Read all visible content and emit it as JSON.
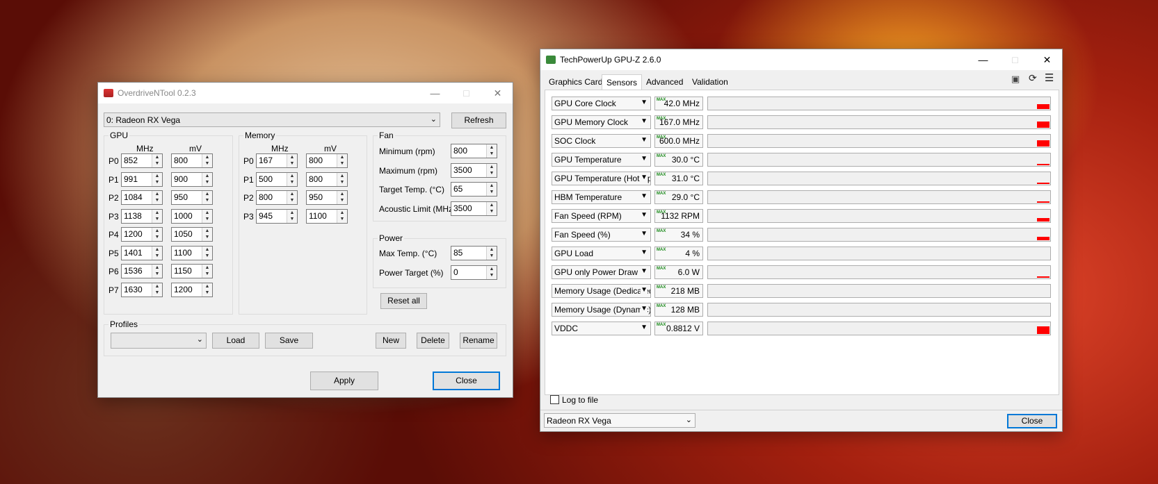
{
  "odnt": {
    "title": "OverdriveNTool 0.2.3",
    "device": "0: Radeon RX Vega",
    "refresh": "Refresh",
    "gpu_caption": "GPU",
    "memory_caption": "Memory",
    "fan_caption": "Fan",
    "power_caption": "Power",
    "profiles_caption": "Profiles",
    "mhz": "MHz",
    "mv": "mV",
    "gpu_states": [
      {
        "label": "P0",
        "mhz": "852",
        "mv": "800"
      },
      {
        "label": "P1",
        "mhz": "991",
        "mv": "900"
      },
      {
        "label": "P2",
        "mhz": "1084",
        "mv": "950"
      },
      {
        "label": "P3",
        "mhz": "1138",
        "mv": "1000"
      },
      {
        "label": "P4",
        "mhz": "1200",
        "mv": "1050"
      },
      {
        "label": "P5",
        "mhz": "1401",
        "mv": "1100"
      },
      {
        "label": "P6",
        "mhz": "1536",
        "mv": "1150"
      },
      {
        "label": "P7",
        "mhz": "1630",
        "mv": "1200"
      }
    ],
    "mem_states": [
      {
        "label": "P0",
        "mhz": "167",
        "mv": "800"
      },
      {
        "label": "P1",
        "mhz": "500",
        "mv": "800"
      },
      {
        "label": "P2",
        "mhz": "800",
        "mv": "950"
      },
      {
        "label": "P3",
        "mhz": "945",
        "mv": "1100"
      }
    ],
    "fan": [
      {
        "label": "Minimum (rpm)",
        "value": "800"
      },
      {
        "label": "Maximum (rpm)",
        "value": "3500"
      },
      {
        "label": "Target Temp. (°C)",
        "value": "65"
      },
      {
        "label": "Acoustic Limit (MHz)",
        "value": "3500"
      }
    ],
    "power": [
      {
        "label": "Max Temp. (°C)",
        "value": "85"
      },
      {
        "label": "Power Target (%)",
        "value": "0"
      }
    ],
    "reset_all": "Reset all",
    "profile_value": "",
    "load": "Load",
    "save": "Save",
    "new": "New",
    "delete": "Delete",
    "rename": "Rename",
    "apply": "Apply",
    "close": "Close"
  },
  "gpuz": {
    "title": "TechPowerUp GPU-Z 2.6.0",
    "tabs": [
      "Graphics Card",
      "Sensors",
      "Advanced",
      "Validation"
    ],
    "active_tab": 1,
    "sensors": [
      {
        "name": "GPU Core Clock",
        "value": "42.0 MHz",
        "fill": 0.45
      },
      {
        "name": "GPU Memory Clock",
        "value": "167.0 MHz",
        "fill": 0.55
      },
      {
        "name": "SOC Clock",
        "value": "600.0 MHz",
        "fill": 0.55
      },
      {
        "name": "GPU Temperature",
        "value": "30.0 °C",
        "fill": 0.08
      },
      {
        "name": "GPU Temperature (Hot Spot)",
        "value": "31.0 °C",
        "fill": 0.08
      },
      {
        "name": "HBM Temperature",
        "value": "29.0 °C",
        "fill": 0.08
      },
      {
        "name": "Fan Speed (RPM)",
        "value": "1132 RPM",
        "fill": 0.3
      },
      {
        "name": "Fan Speed (%)",
        "value": "34 %",
        "fill": 0.3
      },
      {
        "name": "GPU Load",
        "value": "4 %",
        "fill": 0.0
      },
      {
        "name": "GPU only Power Draw",
        "value": "6.0 W",
        "fill": 0.05
      },
      {
        "name": "Memory Usage (Dedicated)",
        "value": "218 MB",
        "fill": 0.0
      },
      {
        "name": "Memory Usage (Dynamic)",
        "value": "128 MB",
        "fill": 0.0
      },
      {
        "name": "VDDC",
        "value": "0.8812 V",
        "fill": 0.7
      }
    ],
    "max_tag": "MAX",
    "log_to_file": "Log to file",
    "device": "Radeon RX Vega",
    "close": "Close"
  },
  "colors": {
    "accent": "#0078d7",
    "graph": "#ff0000",
    "max_tag": "#1a8a1a"
  }
}
